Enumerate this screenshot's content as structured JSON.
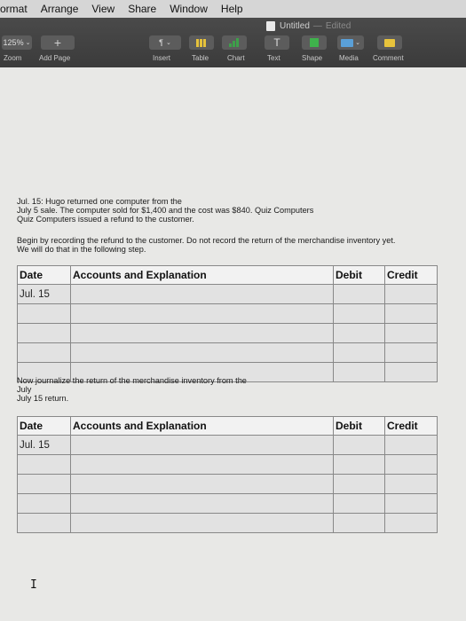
{
  "menubar": {
    "items": [
      "ormat",
      "Arrange",
      "View",
      "Share",
      "Window",
      "Help"
    ]
  },
  "window": {
    "title": "Untitled",
    "status": "Edited"
  },
  "toolbar": {
    "zoom_value": "125%",
    "zoom_label": "Zoom",
    "add_page_label": "Add Page",
    "insert_label": "Insert",
    "table_label": "Table",
    "chart_label": "Chart",
    "text_label": "Text",
    "shape_label": "Shape",
    "media_label": "Media",
    "comment_label": "Comment"
  },
  "document": {
    "intro_line1": "Jul. 15: Hugo returned one computer from the",
    "intro_line2": "July 5 sale. The computer sold for $1,400 and the cost was $840. Quiz Computers",
    "intro_line3": "Quiz Computers issued a refund to the customer.",
    "instruction_line1": "Begin by recording the refund to the customer. Do not record the return of the merchandise inventory yet.",
    "instruction_line2": "We will do that in the following step.",
    "table1": {
      "headers": [
        "Date",
        "Accounts and Explanation",
        "Debit",
        "Credit"
      ],
      "first_date": "Jul. 15"
    },
    "step2_line1": "Now journalize the return of the merchandise inventory from the",
    "step2_line2": "July",
    "step2_line3": "July 15 return.",
    "table2": {
      "headers": [
        "Date",
        "Accounts and Explanation",
        "Debit",
        "Credit"
      ],
      "first_date": "Jul. 15"
    }
  }
}
